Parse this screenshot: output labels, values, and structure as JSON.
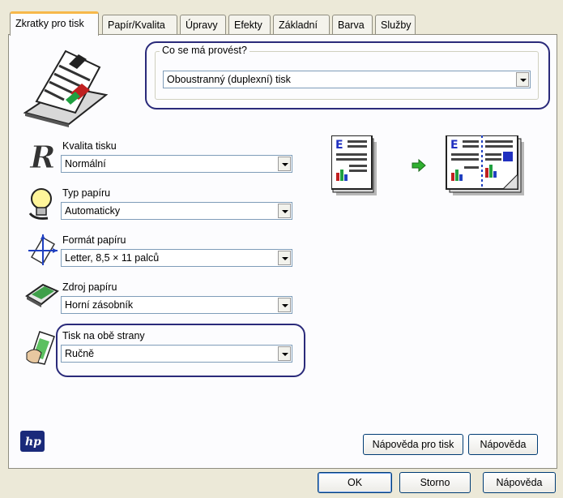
{
  "tabs": [
    {
      "label": "Zkratky pro tisk",
      "active": true
    },
    {
      "label": "Papír/Kvalita"
    },
    {
      "label": "Úpravy"
    },
    {
      "label": "Efekty"
    },
    {
      "label": "Základní"
    },
    {
      "label": "Barva"
    },
    {
      "label": "Služby"
    }
  ],
  "task": {
    "group_label": "Co se má provést?",
    "value": "Oboustranný (duplexní) tisk"
  },
  "settings": {
    "quality": {
      "label": "Kvalita tisku",
      "value": "Normální"
    },
    "paper_type": {
      "label": "Typ papíru",
      "value": "Automaticky"
    },
    "paper_size": {
      "label": "Formát papíru",
      "value": "Letter, 8,5 × 11 palců"
    },
    "paper_source": {
      "label": "Zdroj papíru",
      "value": "Horní zásobník"
    },
    "two_sided": {
      "label": "Tisk na obě strany",
      "value": "Ručně"
    }
  },
  "panel_buttons": {
    "print_help": "Nápověda pro tisk",
    "help": "Nápověda"
  },
  "dialog_buttons": {
    "ok": "OK",
    "cancel": "Storno",
    "help": "Nápověda"
  },
  "icons": {
    "shortcut": "printer-document-icon",
    "quality": "quality-r-icon",
    "paper_type": "lightbulb-icon",
    "paper_size": "paper-size-icon",
    "paper_source": "paper-tray-icon",
    "two_sided": "hand-flip-icon",
    "single_page": "single-page-preview-icon",
    "arrow": "green-arrow-icon",
    "duplex": "duplex-preview-icon",
    "logo": "hp-logo-icon"
  },
  "colors": {
    "highlight": "#2a2a7a",
    "tab_accent": "#f7b84a",
    "dialog_bg": "#ece9d8"
  }
}
